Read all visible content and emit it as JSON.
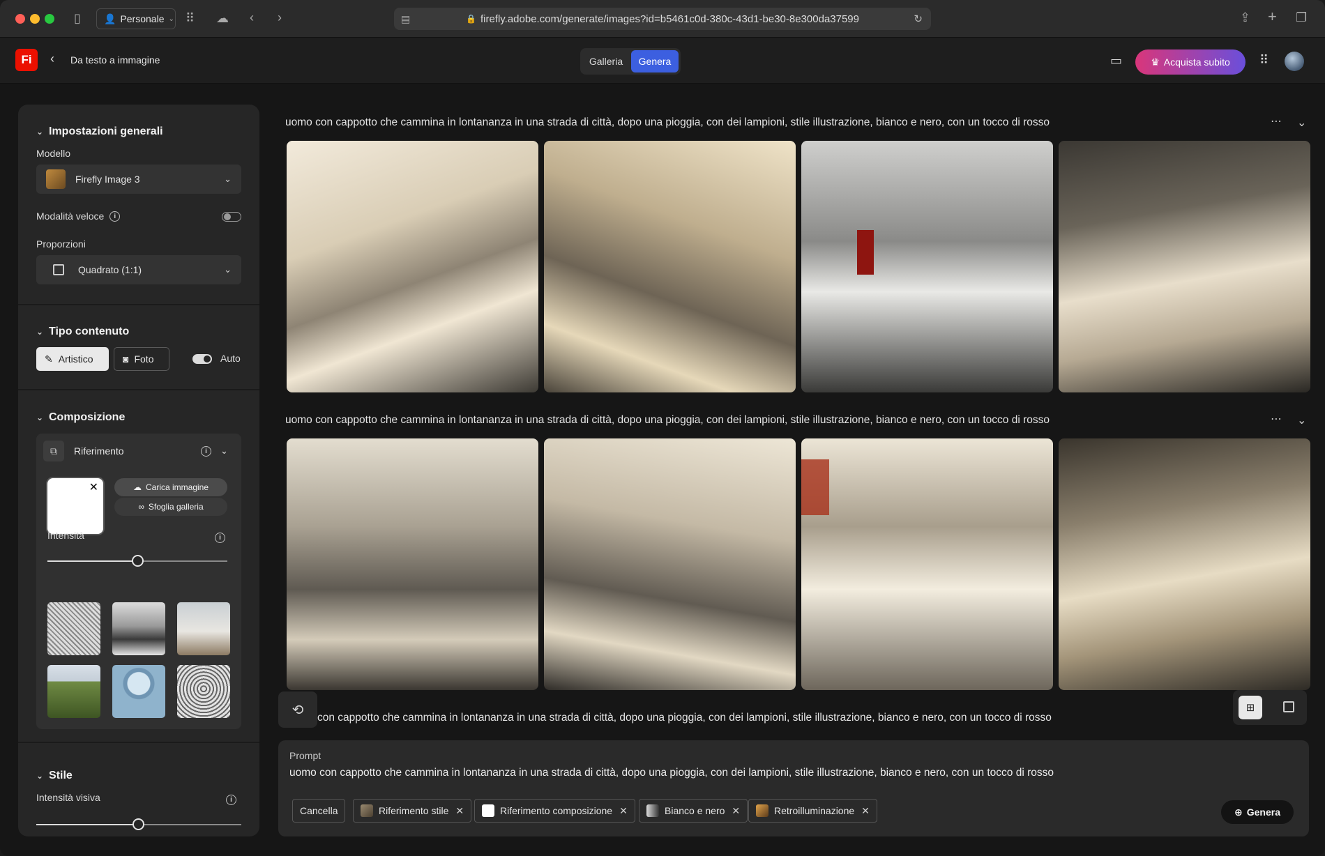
{
  "browser": {
    "profile": "Personale",
    "url": "firefly.adobe.com/generate/images?id=b5461c0d-380c-43d1-be30-8e300da37599"
  },
  "header": {
    "logo": "Fi",
    "breadcrumb": "Da testo a immagine",
    "tabs": [
      "Galleria",
      "Genera"
    ],
    "buy_label": "Acquista subito"
  },
  "sidebar": {
    "general": {
      "title": "Impostazioni generali",
      "model_label": "Modello",
      "model_value": "Firefly Image 3",
      "fast_mode_label": "Modalità veloce",
      "ratio_label": "Proporzioni",
      "ratio_value": "Quadrato (1:1)"
    },
    "content_type": {
      "title": "Tipo contenuto",
      "artistic": "Artistico",
      "photo": "Foto",
      "auto": "Auto"
    },
    "composition": {
      "title": "Composizione",
      "reference": "Riferimento",
      "upload": "Carica immagine",
      "browse": "Sfoglia galleria",
      "intensity": "Intensità",
      "intensity_value": 0.5
    },
    "style": {
      "title": "Stile",
      "visual_intensity": "Intensità visiva",
      "visual_intensity_value": 0.5
    }
  },
  "results": {
    "prompt": "uomo con cappotto che cammina in lontananza in una strada di città, dopo una pioggia, con dei lampioni, stile illustrazione, bianco e nero, con un tocco di rosso",
    "prompt_partial": "con cappotto che cammina in lontananza in una strada di città, dopo una pioggia, con dei lampioni, stile illustrazione, bianco e nero, con un tocco di rosso"
  },
  "prompt_box": {
    "label": "Prompt",
    "text": "uomo con cappotto che cammina in lontananza in una strada di città, dopo una pioggia, con dei lampioni, stile illustrazione, bianco e nero, con un tocco di rosso",
    "clear": "Cancella",
    "tags": [
      "Riferimento stile",
      "Riferimento composizione",
      "Bianco e nero",
      "Retroilluminazione"
    ],
    "generate": "Genera"
  }
}
